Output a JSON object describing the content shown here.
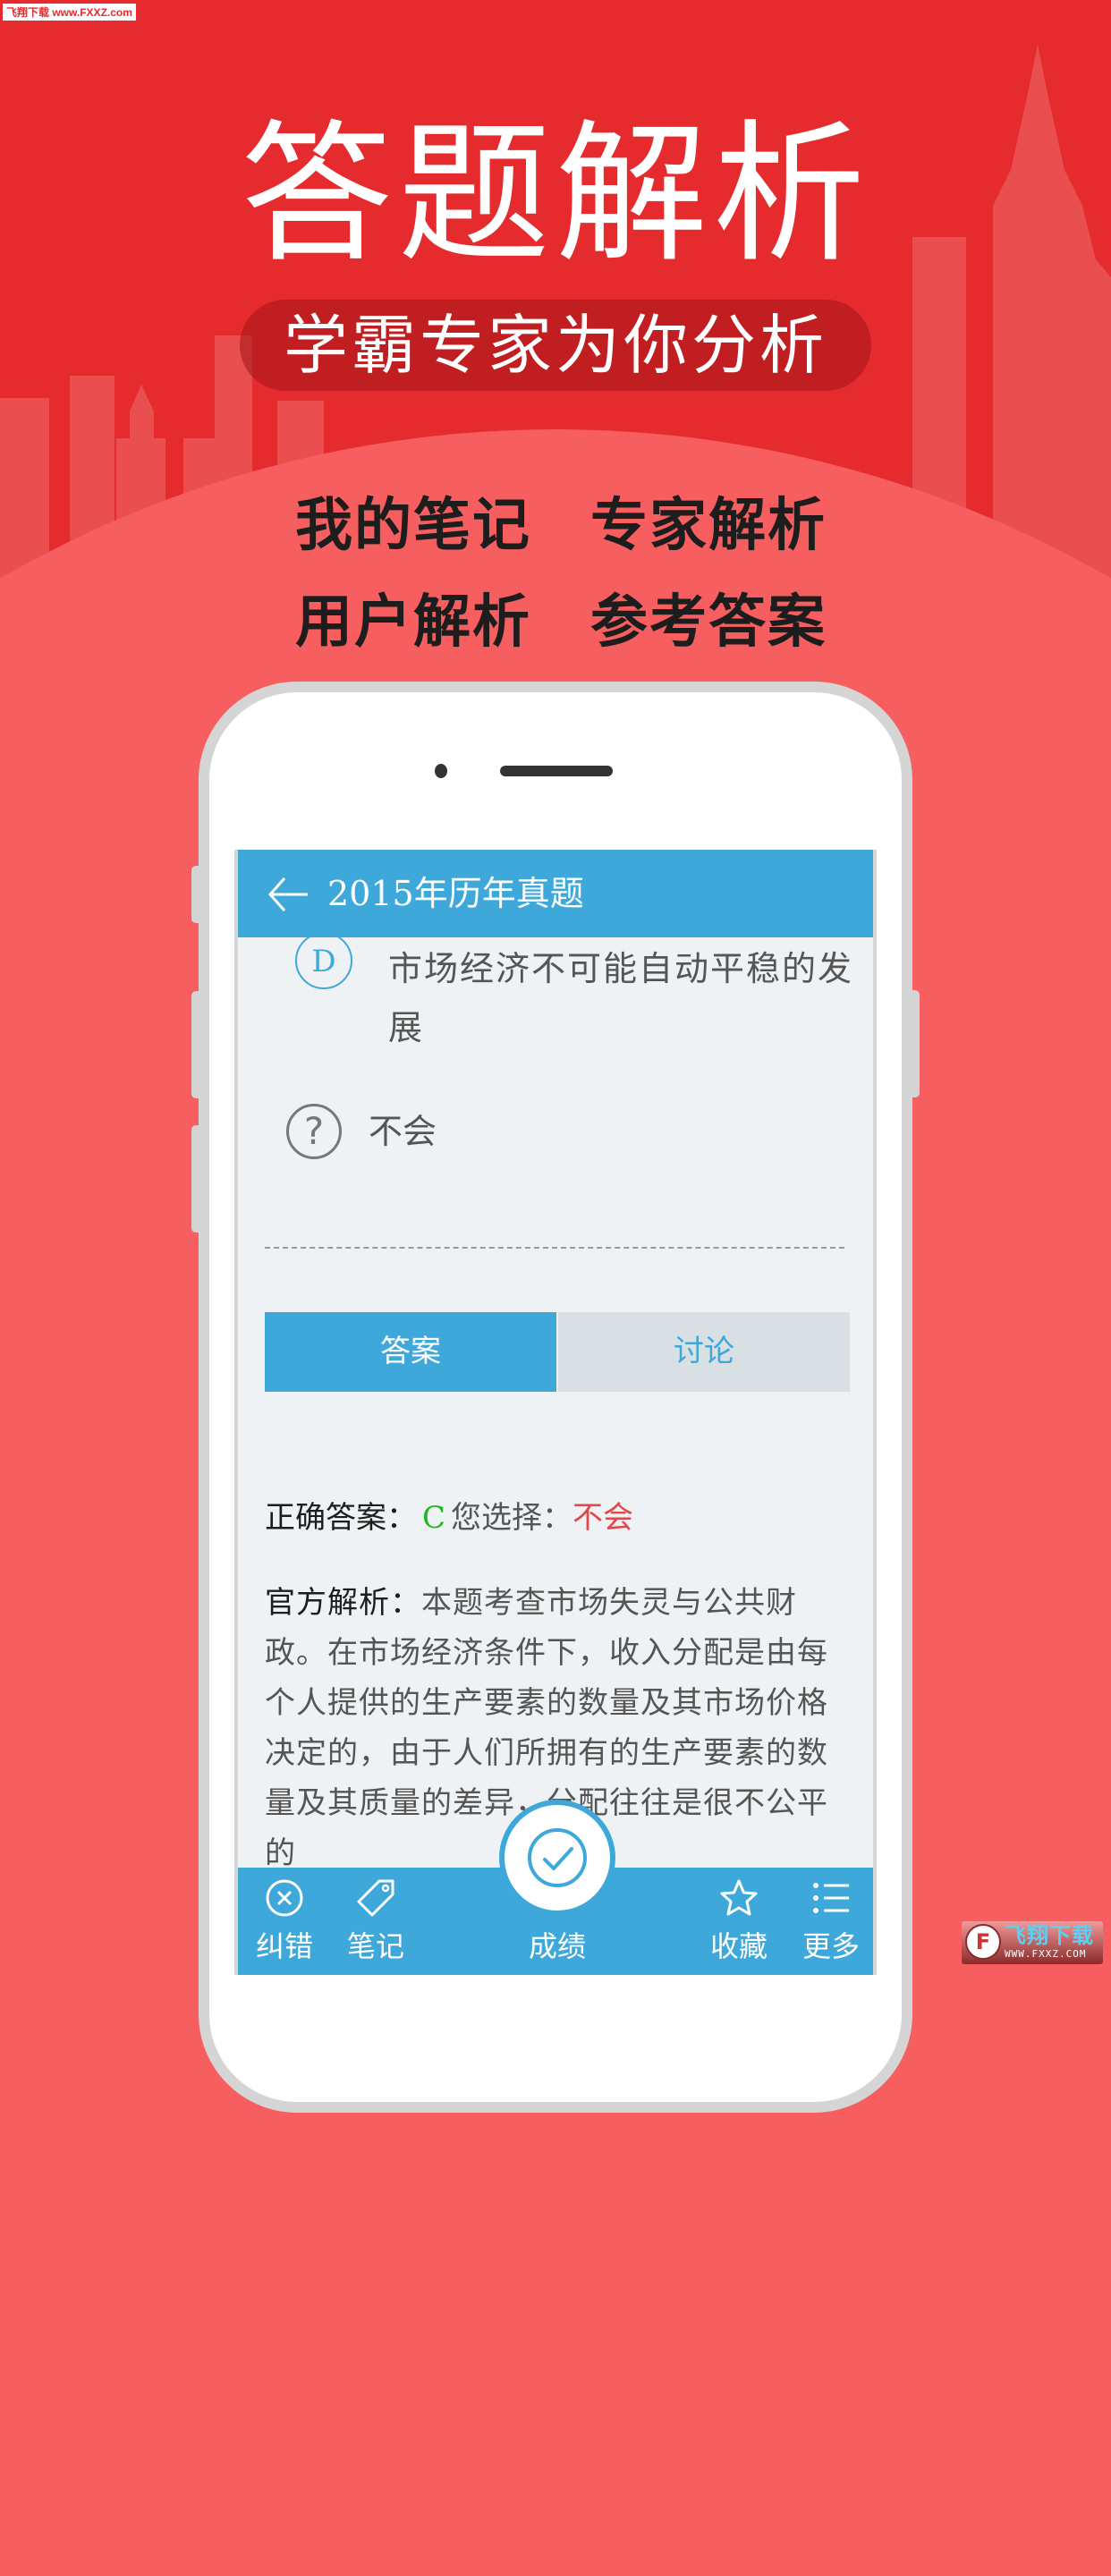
{
  "watermark": "飞翔下载 www.FXXZ.com",
  "banner": {
    "title": "答题解析",
    "subtitle": "学霸专家为你分析",
    "features": [
      "我的笔记",
      "专家解析",
      "用户解析",
      "参考答案"
    ]
  },
  "colors": {
    "brand_red": "#e62b2e",
    "bg_coral": "#f75e5f",
    "app_blue": "#3ea8da",
    "correct_green": "#1fb81f",
    "wrong_red": "#e14848"
  },
  "app": {
    "header": {
      "back_icon": "back-arrow-icon",
      "title": "2015年历年真题"
    },
    "option_d": {
      "letter": "D",
      "text": "市场经济不可能自动平稳的发展"
    },
    "dont_know": {
      "icon": "question-circle-icon",
      "label": "不会"
    },
    "tabs": [
      {
        "label": "答案",
        "active": true
      },
      {
        "label": "讨论",
        "active": false
      }
    ],
    "answer": {
      "correct_label": "正确答案：",
      "correct_value": "C",
      "your_label": "您选择：",
      "your_value": "不会"
    },
    "analysis": {
      "label": "官方解析：",
      "text": "本题考查市场失灵与公共财政。在市场经济条件下，收入分配是由每个人提供的生产要素的数量及其市场价格决定的，由于人们所拥有的生产要素的数量及其质量的差异，分配往往是很不公平的"
    },
    "bottom_nav": [
      {
        "label": "纠错",
        "icon": "close-circle-icon"
      },
      {
        "label": "笔记",
        "icon": "tag-icon"
      },
      {
        "label": "成绩",
        "icon": "check-circle-icon"
      },
      {
        "label": "收藏",
        "icon": "star-icon"
      },
      {
        "label": "更多",
        "icon": "list-icon"
      }
    ]
  },
  "brand_badge": {
    "name": "飞翔下载",
    "url": "WWW.FXXZ.COM"
  }
}
